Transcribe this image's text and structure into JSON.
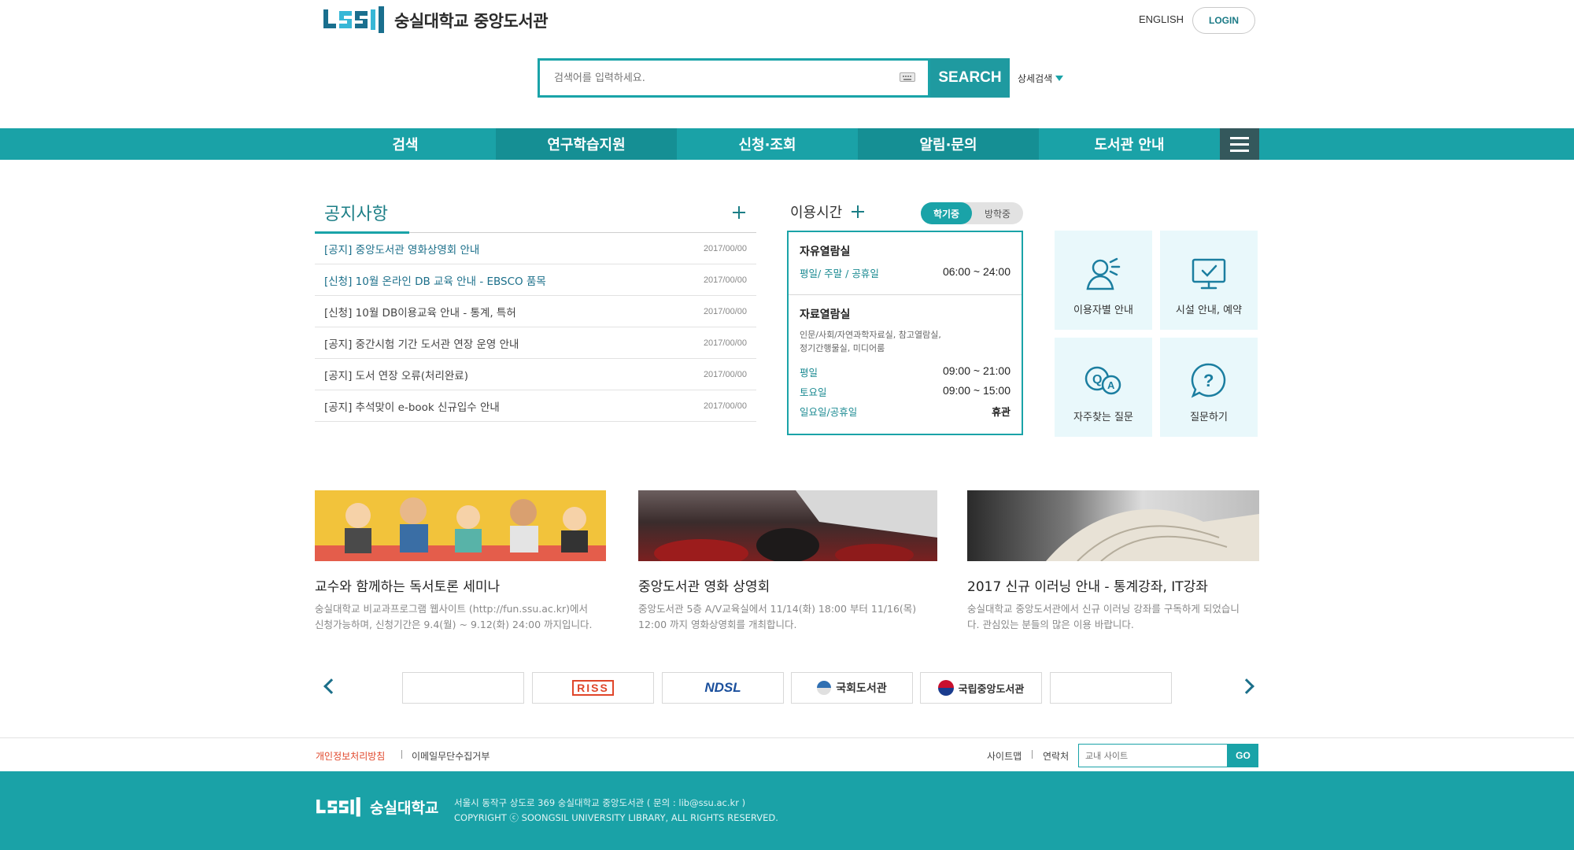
{
  "header": {
    "logo_text": "숭실대학교 중앙도서관",
    "english_label": "ENGLISH",
    "login_label": "LOGIN",
    "search_placeholder": "검색어를 입력하세요.",
    "search_button": "SEARCH",
    "advanced_search": "상세검색"
  },
  "nav": {
    "items": [
      {
        "label": "검색",
        "active": false
      },
      {
        "label": "연구학습지원",
        "active": true
      },
      {
        "label": "신청·조회",
        "active": false
      },
      {
        "label": "알림·문의",
        "active": true
      },
      {
        "label": "도서관 안내",
        "active": false
      }
    ]
  },
  "notice": {
    "title": "공지사항",
    "items": [
      {
        "title": "[공지] 중앙도서관 영화상영회 안내",
        "date": "2017/00/00",
        "highlight": true
      },
      {
        "title": "[신청] 10월 온라인 DB 교육 안내 - EBSCO 품목",
        "date": "2017/00/00",
        "highlight": true
      },
      {
        "title": "[신청] 10월 DB이용교육 안내 - 통계, 특허",
        "date": "2017/00/00",
        "highlight": false
      },
      {
        "title": "[공지] 중간시험 기간 도서관 연장 운영 안내",
        "date": "2017/00/00",
        "highlight": false
      },
      {
        "title": "[공지] 도서 연장 오류(처리완료)",
        "date": "2017/00/00",
        "highlight": false
      },
      {
        "title": "[공지] 추석맞이 e-book 신규입수 안내",
        "date": "2017/00/00",
        "highlight": false
      }
    ]
  },
  "hours": {
    "title": "이용시간",
    "tabs": [
      "학기중",
      "방학중"
    ],
    "rooms": [
      {
        "name": "자유열람실",
        "rows": [
          {
            "label": "평일/ 주말 / 공휴일",
            "value": "06:00 ~ 24:00"
          }
        ]
      },
      {
        "name": "자료열람실",
        "desc": "인문/사회/자연과학자료실, 참고열람실,\n정기간행물실, 미디어룸",
        "rows": [
          {
            "label": "평일",
            "value": "09:00 ~ 21:00"
          },
          {
            "label": "토요일",
            "value": "09:00 ~ 15:00"
          },
          {
            "label": "일요일/공휴일",
            "value": "휴관"
          }
        ]
      }
    ]
  },
  "quick": {
    "user_guide": "이용자별 안내",
    "facility": "시설 안내, 예약",
    "faq": "자주찾는 질문",
    "ask": "질문하기"
  },
  "features": [
    {
      "title": "교수와 함께하는 독서토론 세미나",
      "desc": "숭실대학교 비교과프로그램 웹사이트 (http://fun.ssu.ac.kr)에서\n신청가능하며, 신청기간은 9.4(월) ~ 9.12(화) 24:00 까지입니다."
    },
    {
      "title": "중앙도서관 영화 상영회",
      "desc": "중앙도서관 5층 A/V교육실에서 11/14(화) 18:00 부터 11/16(목)\n12:00 까지 영화상영회를 개최합니다."
    },
    {
      "title": "2017 신규 이러닝 안내 - 통계강좌, IT강좌",
      "desc": "숭실대학교 중앙도서관에서 신규 이러닝 강좌를 구독하게 되었습니\n다. 관심있는 분들의 많은 이용 바랍니다."
    }
  ],
  "partners": {
    "riss": "RISS",
    "ndsl": "NDSL",
    "national_assembly": "국회도서관",
    "national_library": "국립중앙도서관"
  },
  "footer": {
    "privacy": "개인정보처리방침",
    "no_email": "이메일무단수집거부",
    "sitemap": "사이트맵",
    "contact": "연락처",
    "site_search_placeholder": "교내 사이트",
    "go": "GO",
    "logo_text": "숭실대학교",
    "address": "서울시 동작구 상도로 369  숭실대학교 중앙도서관 ( 문의 : lib@ssu.ac.kr )",
    "copyright": "COPYRIGHT  ⓒ  SOONGSIL UNIVERSITY LIBRARY, ALL RIGHTS RESERVED."
  },
  "colors": {
    "brand": "#1aa3a8",
    "brand_dark": "#158f94",
    "accent_text": "#1b6f8a",
    "privacy_red": "#e0462a"
  }
}
